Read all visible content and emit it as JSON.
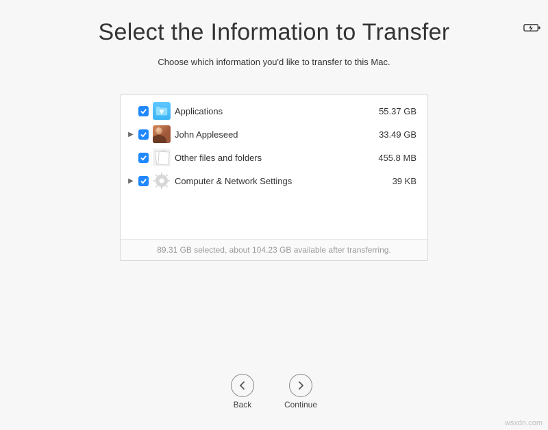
{
  "header": {
    "title": "Select the Information to Transfer",
    "subtitle": "Choose which information you'd like to transfer to this Mac."
  },
  "list": [
    {
      "icon": "applications-icon",
      "label": "Applications",
      "size": "55.37 GB",
      "expandable": false,
      "checked": true
    },
    {
      "icon": "user-avatar-icon",
      "label": "John Appleseed",
      "size": "33.49 GB",
      "expandable": true,
      "checked": true
    },
    {
      "icon": "files-icon",
      "label": "Other files and folders",
      "size": "455.8 MB",
      "expandable": false,
      "checked": true
    },
    {
      "icon": "gear-icon",
      "label": "Computer & Network Settings",
      "size": "39 KB",
      "expandable": true,
      "checked": true
    }
  ],
  "summary": "89.31 GB selected, about 104.23 GB available after transferring.",
  "nav": {
    "back": "Back",
    "continue": "Continue"
  },
  "watermark": "wsxdn.com"
}
